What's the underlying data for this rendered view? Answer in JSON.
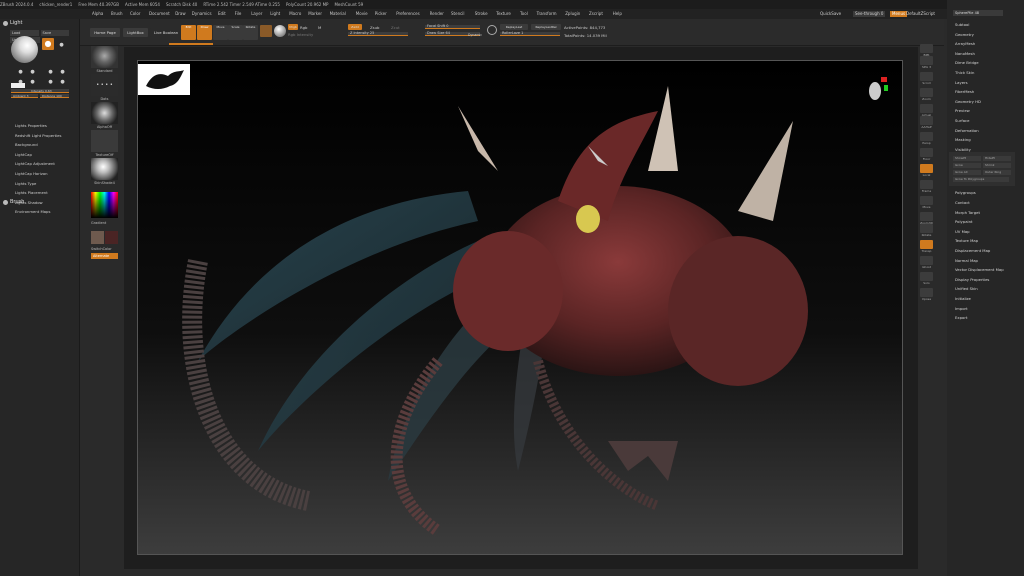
{
  "titlebar": {
    "items": [
      "ZBrush 2024.0.4",
      "chicken_render1",
      "Free Mem 40.397GB",
      "Active Mem 6054",
      "Scratch Disk 40",
      "RTime 2.542 Timer 2.549 ATime 0.255",
      "PolyCount 20.962 MP",
      "MeshCount 59"
    ]
  },
  "menubar": {
    "items": [
      "Alpha",
      "Brush",
      "Color",
      "Document",
      "Draw",
      "Dynamics",
      "Edit",
      "File",
      "Layer",
      "Light",
      "Macro",
      "Marker",
      "Material",
      "Movie",
      "Picker",
      "Preferences",
      "Render",
      "Stencil",
      "Stroke",
      "Texture",
      "Tool",
      "Transform",
      "Zplugin",
      "Zscript",
      "Help"
    ],
    "quicksave": "QuickSave",
    "seethrough": "See-through 0",
    "menus": "Menus",
    "default_script": "DefaultZScript"
  },
  "left_panel": {
    "title": "Light",
    "load": "Load",
    "save": "Save",
    "undo": "Undo",
    "intensity": "Intensity 0.63",
    "ambient": "Ambient 3",
    "distance": "Distance 100",
    "menu": [
      "Lights Properties",
      "Redshift Light Properties",
      "Background",
      "LightCap",
      "LightCap Adjustment",
      "LightCap Horizon",
      "Lights Type",
      "Lights Placement",
      "Lights Shadow",
      "Environment Maps"
    ],
    "brush_title": "Brush"
  },
  "toolbar": {
    "home_page": "Home Page",
    "lightbox": "LightBox",
    "live_boolean": "Live Boolean",
    "edit": "Edit",
    "draw": "Draw",
    "move": "Move",
    "scale": "Scale",
    "rotate": "Rotate",
    "mrgb": "Mrgb",
    "rgb": "Rgb",
    "m": "M",
    "rgb_intensity": "Rgb Intensity",
    "zadd": "Zadd",
    "zsub": "Zsub",
    "zcut": "Zcut",
    "z_intensity": "Z Intensity 25",
    "focal_shift": "Focal Shift 0",
    "draw_size": "Draw Size 64",
    "dynamic": "Dynamic",
    "replay_last": "ReplayLast",
    "replay_last_rel": "ReplayLastRel",
    "active_points": "ActivePoints: 844,773",
    "rollerlaze": "RollerLaze 1",
    "total_points": "TotalPoints: 14.039 Mil"
  },
  "shelf": {
    "items": [
      "Standard",
      "Dots",
      "AlphaOff",
      "TextureOff",
      "SkinShade4",
      "Gradient",
      "SwitchColor",
      "Alternate"
    ]
  },
  "right_strip": {
    "labels": [
      "BPR",
      "SPix 3",
      "Scroll",
      "Zoom",
      "Actual",
      "AAHalf",
      "Persp",
      "Floor",
      "Local",
      "Frame",
      "Move",
      "Zoom3D",
      "Rotate",
      "Transp",
      "Ghost",
      "Solo",
      "Xpose"
    ]
  },
  "right_panel": {
    "top_label": "SpherePile 48",
    "menu": [
      "Subtool",
      "Geometry",
      "ArrayMesh",
      "NanoMesh",
      "Dime Bridge",
      "Thick Skin",
      "Layers",
      "FiberMesh",
      "Geometry HD",
      "Preview",
      "Surface",
      "Deformation",
      "Masking",
      "Visibility",
      "Polygroups",
      "Contact",
      "Morph Target",
      "Polypaint",
      "UV Map",
      "Texture Map",
      "Displacement Map",
      "Normal Map",
      "Vector Displacement Map",
      "Display Properties",
      "Unified Skin",
      "Initialize",
      "Import",
      "Export"
    ],
    "visibility_buttons": [
      "ShowPt",
      "HidePt",
      "Grow",
      "Shrink",
      "Grow All",
      "Outer Ring",
      "Grow To Polygroups"
    ]
  },
  "colors": {
    "accent": "#d07a1e",
    "panel": "#262626",
    "viewport": "#1e1e1e"
  }
}
